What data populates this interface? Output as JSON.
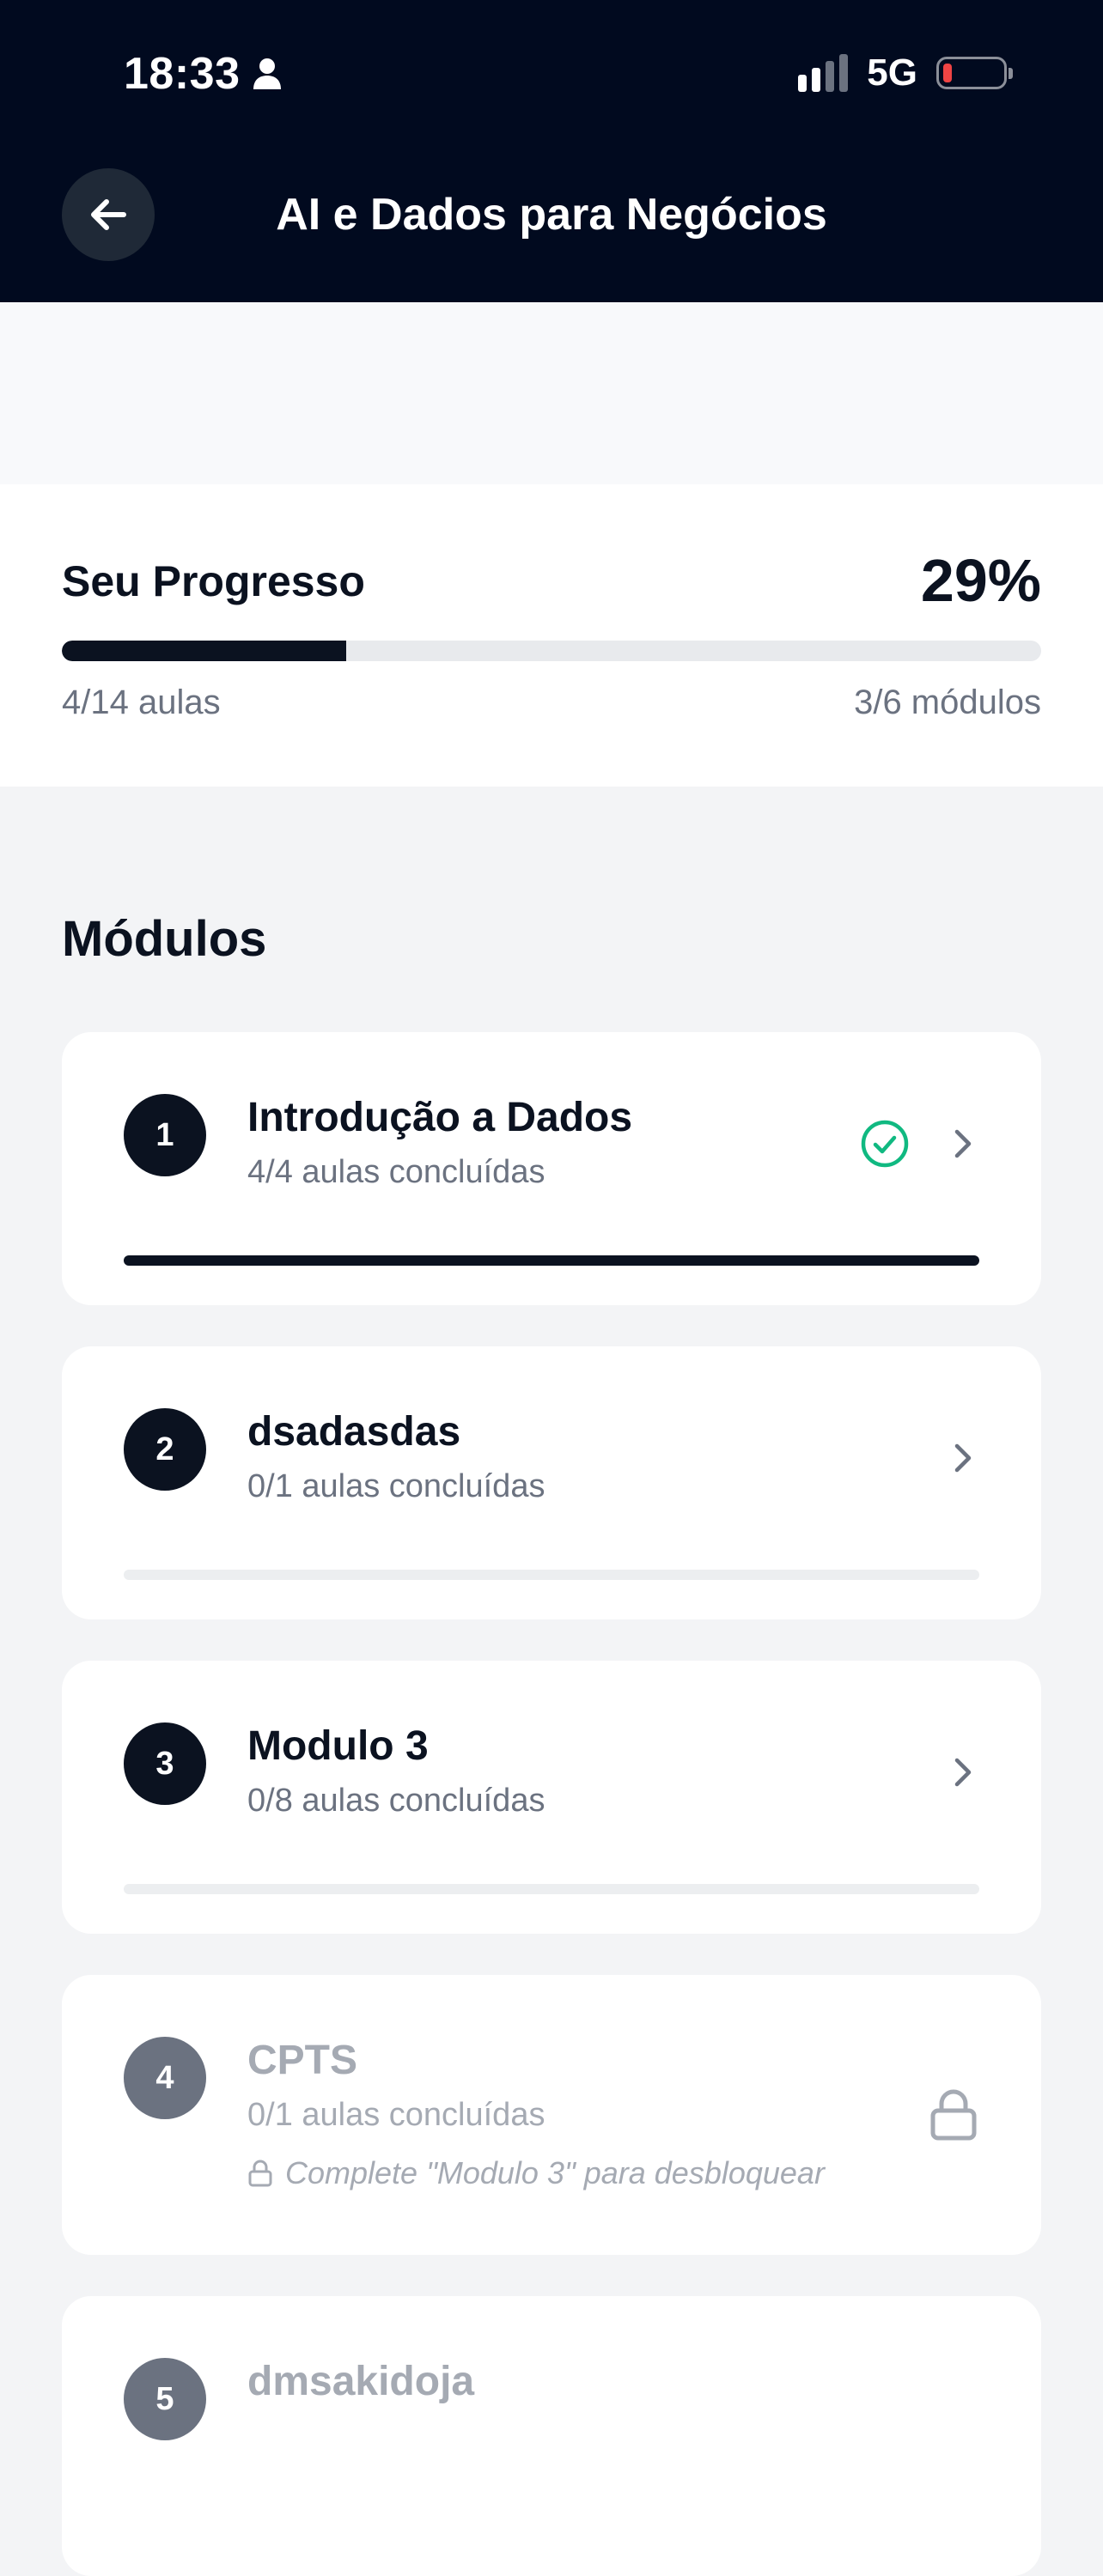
{
  "status_bar": {
    "time": "18:33",
    "network": "5G",
    "battery_level_pct": 8
  },
  "header": {
    "title": "AI e Dados para Negócios"
  },
  "progress": {
    "label": "Seu Progresso",
    "percent_text": "29%",
    "percent": 29,
    "lessons_text": "4/14 aulas",
    "modules_text": "3/6 módulos"
  },
  "modules_section": {
    "title": "Módulos"
  },
  "modules": [
    {
      "number": "1",
      "title": "Introdução a Dados",
      "subtitle": "4/4 aulas concluídas",
      "progress": 1.0,
      "completed": true,
      "locked": false
    },
    {
      "number": "2",
      "title": "dsadasdas",
      "subtitle": "0/1 aulas concluídas",
      "progress": 0,
      "completed": false,
      "locked": false
    },
    {
      "number": "3",
      "title": "Modulo 3",
      "subtitle": "0/8 aulas concluídas",
      "progress": 0,
      "completed": false,
      "locked": false
    },
    {
      "number": "4",
      "title": "CPTS",
      "subtitle": "0/1 aulas concluídas",
      "locked": true,
      "unlock_hint": "Complete \"Modulo 3\" para desbloquear"
    },
    {
      "number": "5",
      "title": "dmsakidoja",
      "locked": true
    }
  ],
  "icons": {
    "back": "arrow-left-icon",
    "chevron": "chevron-right-icon",
    "complete": "check-circle-icon",
    "lock": "lock-icon",
    "person": "person-icon"
  },
  "colors": {
    "header_bg": "#010a1f",
    "accent": "#0b1220",
    "success": "#10b981",
    "muted": "#6b7280",
    "battery_low": "#ef4444"
  }
}
